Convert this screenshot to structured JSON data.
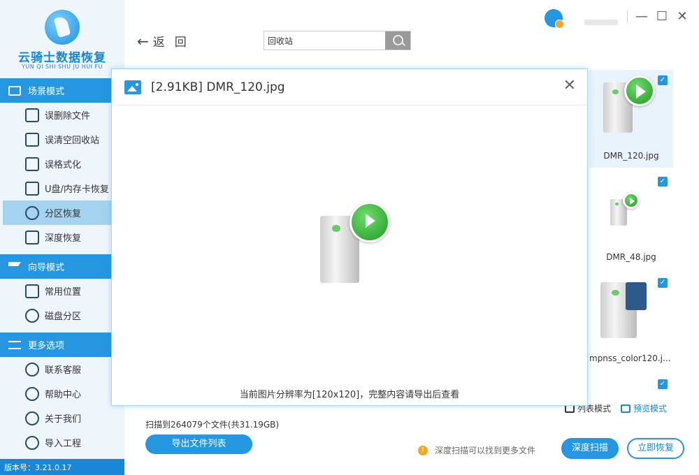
{
  "app": {
    "title": "云骑士数据恢复",
    "subtitle": "YUN QI SHI SHU JU HUI FU",
    "version": "版本号：3.21.0.17"
  },
  "window": {
    "minimize": "—",
    "maximize": "☐",
    "close": "✕"
  },
  "sidebar": {
    "sections": [
      {
        "title": "场景模式",
        "items": [
          "误删除文件",
          "误清空回收站",
          "误格式化",
          "U盘/内存卡恢复",
          "分区恢复",
          "深度恢复"
        ]
      },
      {
        "title": "向导模式",
        "items": [
          "常用位置",
          "磁盘分区"
        ]
      },
      {
        "title": "更多选项",
        "items": [
          "联系客服",
          "帮助中心",
          "关于我们",
          "导入工程"
        ]
      }
    ],
    "active_item": "分区恢复"
  },
  "toolbar": {
    "back_label": "返回",
    "search_value": "回收站"
  },
  "thumbnails": [
    {
      "name": "DMR_120.jpg",
      "checked": true,
      "selected": true
    },
    {
      "name": "DMR_48.jpg",
      "checked": true,
      "selected": false
    },
    {
      "name": "mpnss_color120.j...",
      "checked": true,
      "selected": false
    },
    {
      "name": "",
      "checked": true,
      "selected": false
    }
  ],
  "view_modes": {
    "list": "列表模式",
    "preview": "预览模式"
  },
  "status": {
    "scan_info": "扫描到264079个文件(共31.19GB)",
    "tip": "深度扫描可以找到更多文件"
  },
  "buttons": {
    "export": "导出文件列表",
    "deep_scan": "深度扫描",
    "recover": "立即恢复"
  },
  "modal": {
    "title": "[2.91KB] DMR_120.jpg",
    "footer": "当前图片分辨率为[120x120]，完整内容请导出后查看",
    "close": "✕"
  },
  "colors": {
    "accent": "#2596e0",
    "sidebar_bg": "#eef6fb",
    "active_bg": "#a3d3ee"
  }
}
